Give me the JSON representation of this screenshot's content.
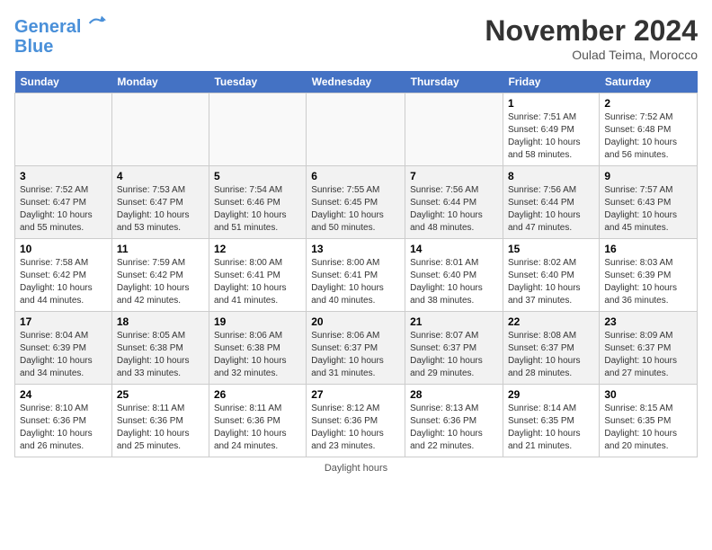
{
  "header": {
    "logo_line1": "General",
    "logo_line2": "Blue",
    "month_title": "November 2024",
    "location": "Oulad Teima, Morocco"
  },
  "weekdays": [
    "Sunday",
    "Monday",
    "Tuesday",
    "Wednesday",
    "Thursday",
    "Friday",
    "Saturday"
  ],
  "weeks": [
    [
      {
        "day": "",
        "text": ""
      },
      {
        "day": "",
        "text": ""
      },
      {
        "day": "",
        "text": ""
      },
      {
        "day": "",
        "text": ""
      },
      {
        "day": "",
        "text": ""
      },
      {
        "day": "1",
        "text": "Sunrise: 7:51 AM\nSunset: 6:49 PM\nDaylight: 10 hours and 58 minutes."
      },
      {
        "day": "2",
        "text": "Sunrise: 7:52 AM\nSunset: 6:48 PM\nDaylight: 10 hours and 56 minutes."
      }
    ],
    [
      {
        "day": "3",
        "text": "Sunrise: 7:52 AM\nSunset: 6:47 PM\nDaylight: 10 hours and 55 minutes."
      },
      {
        "day": "4",
        "text": "Sunrise: 7:53 AM\nSunset: 6:47 PM\nDaylight: 10 hours and 53 minutes."
      },
      {
        "day": "5",
        "text": "Sunrise: 7:54 AM\nSunset: 6:46 PM\nDaylight: 10 hours and 51 minutes."
      },
      {
        "day": "6",
        "text": "Sunrise: 7:55 AM\nSunset: 6:45 PM\nDaylight: 10 hours and 50 minutes."
      },
      {
        "day": "7",
        "text": "Sunrise: 7:56 AM\nSunset: 6:44 PM\nDaylight: 10 hours and 48 minutes."
      },
      {
        "day": "8",
        "text": "Sunrise: 7:56 AM\nSunset: 6:44 PM\nDaylight: 10 hours and 47 minutes."
      },
      {
        "day": "9",
        "text": "Sunrise: 7:57 AM\nSunset: 6:43 PM\nDaylight: 10 hours and 45 minutes."
      }
    ],
    [
      {
        "day": "10",
        "text": "Sunrise: 7:58 AM\nSunset: 6:42 PM\nDaylight: 10 hours and 44 minutes."
      },
      {
        "day": "11",
        "text": "Sunrise: 7:59 AM\nSunset: 6:42 PM\nDaylight: 10 hours and 42 minutes."
      },
      {
        "day": "12",
        "text": "Sunrise: 8:00 AM\nSunset: 6:41 PM\nDaylight: 10 hours and 41 minutes."
      },
      {
        "day": "13",
        "text": "Sunrise: 8:00 AM\nSunset: 6:41 PM\nDaylight: 10 hours and 40 minutes."
      },
      {
        "day": "14",
        "text": "Sunrise: 8:01 AM\nSunset: 6:40 PM\nDaylight: 10 hours and 38 minutes."
      },
      {
        "day": "15",
        "text": "Sunrise: 8:02 AM\nSunset: 6:40 PM\nDaylight: 10 hours and 37 minutes."
      },
      {
        "day": "16",
        "text": "Sunrise: 8:03 AM\nSunset: 6:39 PM\nDaylight: 10 hours and 36 minutes."
      }
    ],
    [
      {
        "day": "17",
        "text": "Sunrise: 8:04 AM\nSunset: 6:39 PM\nDaylight: 10 hours and 34 minutes."
      },
      {
        "day": "18",
        "text": "Sunrise: 8:05 AM\nSunset: 6:38 PM\nDaylight: 10 hours and 33 minutes."
      },
      {
        "day": "19",
        "text": "Sunrise: 8:06 AM\nSunset: 6:38 PM\nDaylight: 10 hours and 32 minutes."
      },
      {
        "day": "20",
        "text": "Sunrise: 8:06 AM\nSunset: 6:37 PM\nDaylight: 10 hours and 31 minutes."
      },
      {
        "day": "21",
        "text": "Sunrise: 8:07 AM\nSunset: 6:37 PM\nDaylight: 10 hours and 29 minutes."
      },
      {
        "day": "22",
        "text": "Sunrise: 8:08 AM\nSunset: 6:37 PM\nDaylight: 10 hours and 28 minutes."
      },
      {
        "day": "23",
        "text": "Sunrise: 8:09 AM\nSunset: 6:37 PM\nDaylight: 10 hours and 27 minutes."
      }
    ],
    [
      {
        "day": "24",
        "text": "Sunrise: 8:10 AM\nSunset: 6:36 PM\nDaylight: 10 hours and 26 minutes."
      },
      {
        "day": "25",
        "text": "Sunrise: 8:11 AM\nSunset: 6:36 PM\nDaylight: 10 hours and 25 minutes."
      },
      {
        "day": "26",
        "text": "Sunrise: 8:11 AM\nSunset: 6:36 PM\nDaylight: 10 hours and 24 minutes."
      },
      {
        "day": "27",
        "text": "Sunrise: 8:12 AM\nSunset: 6:36 PM\nDaylight: 10 hours and 23 minutes."
      },
      {
        "day": "28",
        "text": "Sunrise: 8:13 AM\nSunset: 6:36 PM\nDaylight: 10 hours and 22 minutes."
      },
      {
        "day": "29",
        "text": "Sunrise: 8:14 AM\nSunset: 6:35 PM\nDaylight: 10 hours and 21 minutes."
      },
      {
        "day": "30",
        "text": "Sunrise: 8:15 AM\nSunset: 6:35 PM\nDaylight: 10 hours and 20 minutes."
      }
    ]
  ],
  "footer": "Daylight hours"
}
